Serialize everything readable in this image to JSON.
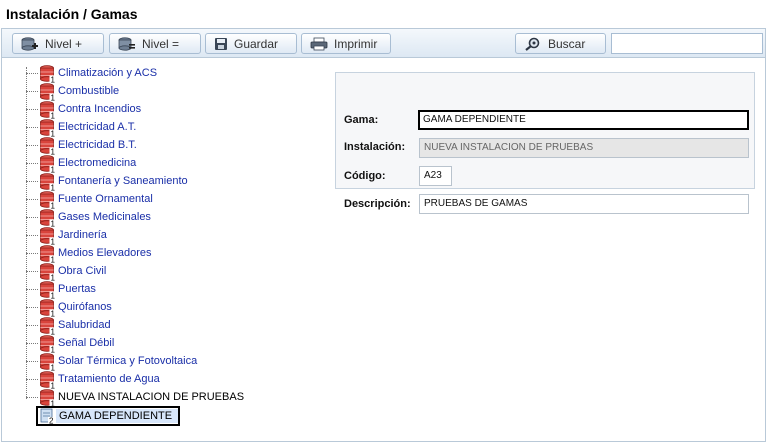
{
  "page": {
    "title": "Instalación / Gamas"
  },
  "toolbar": {
    "nivel_add_label": "Nivel +",
    "nivel_eq_label": "Nivel =",
    "guardar_label": "Guardar",
    "imprimir_label": "Imprimir",
    "buscar_label": "Buscar",
    "search_value": ""
  },
  "tree": {
    "items": [
      {
        "label": "Climatización y ACS",
        "badge": "1"
      },
      {
        "label": "Combustible",
        "badge": "1"
      },
      {
        "label": "Contra Incendios",
        "badge": "1"
      },
      {
        "label": "Electricidad A.T.",
        "badge": "1"
      },
      {
        "label": "Electricidad B.T.",
        "badge": "1"
      },
      {
        "label": "Electromedicina",
        "badge": "1"
      },
      {
        "label": "Fontanería y Saneamiento",
        "badge": "1"
      },
      {
        "label": "Fuente Ornamental",
        "badge": "1"
      },
      {
        "label": "Gases Medicinales",
        "badge": "1"
      },
      {
        "label": "Jardinería",
        "badge": "1"
      },
      {
        "label": "Medios Elevadores",
        "badge": "1"
      },
      {
        "label": "Obra Civil",
        "badge": "1"
      },
      {
        "label": "Puertas",
        "badge": "1"
      },
      {
        "label": "Quirófanos",
        "badge": "1"
      },
      {
        "label": "Salubridad",
        "badge": "1"
      },
      {
        "label": "Señal Débil",
        "badge": "1"
      },
      {
        "label": "Solar Térmica y Fotovoltaica",
        "badge": "1"
      },
      {
        "label": "Tratamiento de Agua",
        "badge": "1"
      },
      {
        "label": "NUEVA INSTALACION DE PRUEBAS",
        "badge": "1"
      }
    ],
    "child": {
      "label": "GAMA DEPENDIENTE",
      "badge": "2"
    }
  },
  "form": {
    "gama_label": "Gama:",
    "gama_value": "GAMA DEPENDIENTE",
    "instalacion_label": "Instalación:",
    "instalacion_value": "NUEVA INSTALACION DE PRUEBAS",
    "codigo_label": "Código:",
    "codigo_value": "A23",
    "descripcion_label": "Descripción:",
    "descripcion_value": "PRUEBAS DE GAMAS"
  },
  "colors": {
    "node_icon": "#d9443c",
    "link_text": "#1a2fa8",
    "selection": "#d7e6fa"
  },
  "icons": {
    "nivel_add": "database-plus-icon",
    "nivel_eq": "database-equals-icon",
    "guardar": "floppy-disk-icon",
    "imprimir": "printer-icon",
    "buscar": "magnifier-icon",
    "tree_node": "stacked-database-icon",
    "tree_leaf": "document-icon"
  }
}
